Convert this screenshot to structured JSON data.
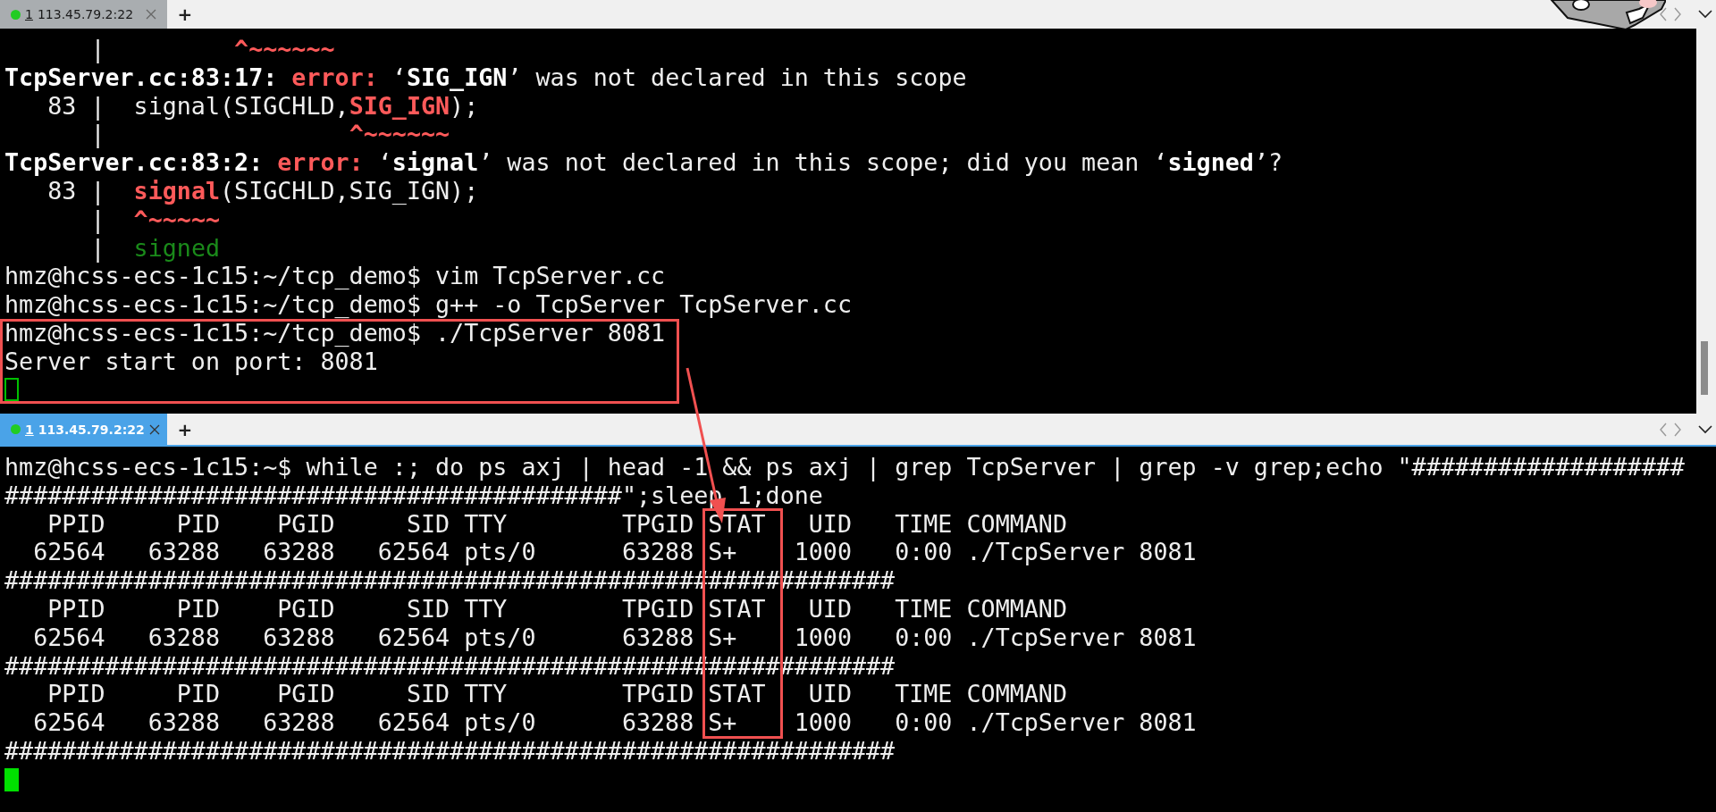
{
  "panes": [
    {
      "tab": {
        "number": "1",
        "title": "113.45.79.2:22",
        "connected": true,
        "selected": false
      },
      "new_tab_button": "+",
      "annotation": {
        "kind": "rows_box"
      },
      "lines": [
        {
          "kind": "text",
          "segments": [
            {
              "text": "      |         ",
              "kind": "plain"
            },
            {
              "text": "^~~~~~~",
              "kind": "error"
            }
          ]
        },
        {
          "kind": "text",
          "segments": [
            {
              "text": "TcpServer.cc:83:17: ",
              "kind": "bold"
            },
            {
              "text": "error:",
              "kind": "error"
            },
            {
              "text": " ‘",
              "kind": "plain"
            },
            {
              "text": "SIG_IGN",
              "kind": "bold"
            },
            {
              "text": "’ was not declared in this scope",
              "kind": "plain"
            }
          ]
        },
        {
          "kind": "text",
          "segments": [
            {
              "text": "   83 |  signal(SIGCHLD,",
              "kind": "plain"
            },
            {
              "text": "SIG_IGN",
              "kind": "error"
            },
            {
              "text": ");",
              "kind": "plain"
            }
          ]
        },
        {
          "kind": "text",
          "segments": [
            {
              "text": "      |                 ",
              "kind": "plain"
            },
            {
              "text": "^~~~~~~",
              "kind": "error"
            }
          ]
        },
        {
          "kind": "text",
          "segments": [
            {
              "text": "TcpServer.cc:83:2: ",
              "kind": "bold"
            },
            {
              "text": "error:",
              "kind": "error"
            },
            {
              "text": " ‘",
              "kind": "plain"
            },
            {
              "text": "signal",
              "kind": "bold"
            },
            {
              "text": "’ was not declared in this scope; did you mean ‘",
              "kind": "plain"
            },
            {
              "text": "signed",
              "kind": "bold"
            },
            {
              "text": "’?",
              "kind": "plain"
            }
          ]
        },
        {
          "kind": "text",
          "segments": [
            {
              "text": "   83 |  ",
              "kind": "plain"
            },
            {
              "text": "signal",
              "kind": "error"
            },
            {
              "text": "(SIGCHLD,SIG_IGN);",
              "kind": "plain"
            }
          ]
        },
        {
          "kind": "text",
          "segments": [
            {
              "text": "      |  ",
              "kind": "plain"
            },
            {
              "text": "^~~~~~",
              "kind": "error"
            }
          ]
        },
        {
          "kind": "text",
          "segments": [
            {
              "text": "      |  ",
              "kind": "plain"
            },
            {
              "text": "signed",
              "kind": "hint"
            }
          ]
        },
        {
          "kind": "text",
          "segments": [
            {
              "text": "hmz@hcss-ecs-1c15:~/tcp_demo$ vim TcpServer.cc",
              "kind": "plain"
            }
          ]
        },
        {
          "kind": "text",
          "segments": [
            {
              "text": "hmz@hcss-ecs-1c15:~/tcp_demo$ g++ -o TcpServer TcpServer.cc",
              "kind": "plain"
            }
          ]
        },
        {
          "kind": "text",
          "segments": [
            {
              "text": "hmz@hcss-ecs-1c15:~/tcp_demo$ ./TcpServer 8081",
              "kind": "plain"
            }
          ]
        },
        {
          "kind": "text",
          "segments": [
            {
              "text": "Server start on port: 8081",
              "kind": "plain"
            }
          ]
        },
        {
          "kind": "cursor",
          "focused": false
        }
      ]
    },
    {
      "tab": {
        "number": "1",
        "title": "113.45.79.2:22",
        "connected": true,
        "selected": true
      },
      "new_tab_button": "+",
      "annotation": {
        "kind": "column_box"
      },
      "lines": [
        {
          "kind": "text",
          "segments": [
            {
              "text": "hmz@hcss-ecs-1c15:~$ while :; do ps axj | head -1 && ps axj | grep TcpServer | grep -v grep;echo \"###################",
              "kind": "plain"
            }
          ]
        },
        {
          "kind": "text",
          "segments": [
            {
              "text": "###########################################\";sleep 1;done",
              "kind": "plain"
            }
          ]
        },
        {
          "kind": "text",
          "segments": [
            {
              "text": "   PPID     PID    PGID     SID TTY        TPGID STAT   UID   TIME COMMAND",
              "kind": "plain"
            }
          ]
        },
        {
          "kind": "text",
          "segments": [
            {
              "text": "  62564   63288   63288   62564 pts/0      63288 S+    1000   0:00 ./TcpServer 8081",
              "kind": "plain"
            }
          ]
        },
        {
          "kind": "text",
          "segments": [
            {
              "text": "##############################################################",
              "kind": "plain"
            }
          ]
        },
        {
          "kind": "text",
          "segments": [
            {
              "text": "   PPID     PID    PGID     SID TTY        TPGID STAT   UID   TIME COMMAND",
              "kind": "plain"
            }
          ]
        },
        {
          "kind": "text",
          "segments": [
            {
              "text": "  62564   63288   63288   62564 pts/0      63288 S+    1000   0:00 ./TcpServer 8081",
              "kind": "plain"
            }
          ]
        },
        {
          "kind": "text",
          "segments": [
            {
              "text": "##############################################################",
              "kind": "plain"
            }
          ]
        },
        {
          "kind": "text",
          "segments": [
            {
              "text": "   PPID     PID    PGID     SID TTY        TPGID STAT   UID   TIME COMMAND",
              "kind": "plain"
            }
          ]
        },
        {
          "kind": "text",
          "segments": [
            {
              "text": "  62564   63288   63288   62564 pts/0      63288 S+    1000   0:00 ./TcpServer 8081",
              "kind": "plain"
            }
          ]
        },
        {
          "kind": "text",
          "segments": [
            {
              "text": "##############################################################",
              "kind": "plain"
            }
          ]
        },
        {
          "kind": "cursor",
          "focused": true
        }
      ]
    }
  ],
  "annotation": {
    "kind": "arrow"
  }
}
